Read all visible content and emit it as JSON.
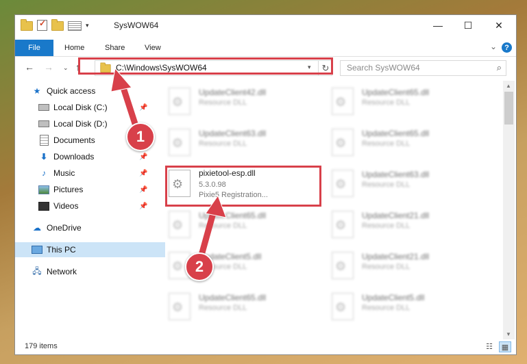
{
  "window": {
    "title": "SysWOW64",
    "controls": {
      "minimize": "—",
      "maximize": "☐",
      "close": "✕"
    }
  },
  "ribbon": {
    "tabs": [
      "File",
      "Home",
      "Share",
      "View"
    ],
    "help": "?"
  },
  "address_bar": {
    "path": "C:\\Windows\\SysWOW64",
    "refresh_glyph": "↻"
  },
  "search": {
    "placeholder": "Search SysWOW64"
  },
  "sidebar": {
    "items": [
      {
        "label": "Quick access",
        "icon": "star-icon"
      },
      {
        "label": "Local Disk (C:)",
        "icon": "drive-icon",
        "pinned": true
      },
      {
        "label": "Local Disk (D:)",
        "icon": "drive-icon"
      },
      {
        "label": "Documents",
        "icon": "documents-icon",
        "pinned": true
      },
      {
        "label": "Downloads",
        "icon": "downloads-icon",
        "pinned": true
      },
      {
        "label": "Music",
        "icon": "music-icon",
        "pinned": true
      },
      {
        "label": "Pictures",
        "icon": "pictures-icon",
        "pinned": true
      },
      {
        "label": "Videos",
        "icon": "videos-icon",
        "pinned": true
      },
      {
        "label": "OneDrive",
        "icon": "cloud-icon"
      },
      {
        "label": "This PC",
        "icon": "computer-icon",
        "selected": true
      },
      {
        "label": "Network",
        "icon": "network-icon"
      }
    ]
  },
  "files": [
    {
      "name": "UpdateClient42.dll",
      "type": "Resource DLL",
      "blurred": true
    },
    {
      "name": "UpdateClient65.dll",
      "type": "Resource DLL",
      "blurred": true
    },
    {
      "name": "UpdateClient63.dll",
      "type": "Resource DLL",
      "blurred": true
    },
    {
      "name": "UpdateClient65.dll",
      "type": "Resource DLL",
      "blurred": true
    },
    {
      "name": "pixietool-esp.dll",
      "version": "5.3.0.98",
      "description": "Pixie5 Registration...",
      "blurred": false
    },
    {
      "name": "UpdateClient63.dll",
      "type": "Resource DLL",
      "blurred": true
    },
    {
      "name": "UpdateClient65.dll",
      "type": "Resource DLL",
      "blurred": true
    },
    {
      "name": "UpdateClient21.dll",
      "type": "Resource DLL",
      "blurred": true
    },
    {
      "name": "UpdateClient5.dll",
      "type": "Resource DLL",
      "blurred": true
    },
    {
      "name": "UpdateClient21.dll",
      "type": "Resource DLL",
      "blurred": true
    },
    {
      "name": "UpdateClient65.dll",
      "type": "Resource DLL",
      "blurred": true
    },
    {
      "name": "UpdateClient5.dll",
      "type": "Resource DLL",
      "blurred": true
    }
  ],
  "status": {
    "item_count": "179 items"
  },
  "annotations": {
    "step1": "1",
    "step2": "2"
  },
  "colors": {
    "accent": "#1979ca",
    "highlight": "#d8404a",
    "selected": "#cce4f7"
  }
}
